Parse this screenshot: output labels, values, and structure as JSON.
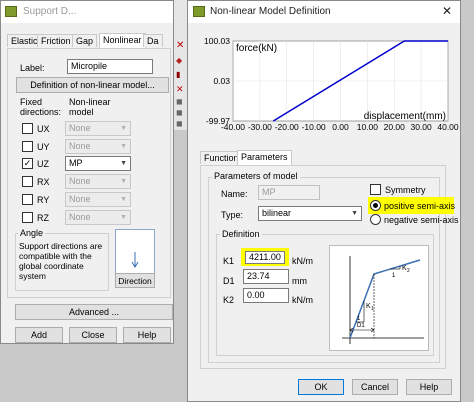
{
  "support_dialog": {
    "title": "Support D...",
    "tabs": [
      "Elastic",
      "Friction",
      "Gap",
      "Nonlinear",
      "Da"
    ],
    "label_caption": "Label:",
    "label_value": "Micropile",
    "definition_button": "Definition of non-linear model...",
    "fixed_directions_header": "Fixed\ndirections:",
    "nonlinear_model_header": "Non-linear\nmodel",
    "directions": [
      {
        "name": "UX",
        "checked": false,
        "model": "None"
      },
      {
        "name": "UY",
        "checked": false,
        "model": "None"
      },
      {
        "name": "UZ",
        "checked": true,
        "model": "MP"
      },
      {
        "name": "RX",
        "checked": false,
        "model": "None"
      },
      {
        "name": "RY",
        "checked": false,
        "model": "None"
      },
      {
        "name": "RZ",
        "checked": false,
        "model": "None"
      }
    ],
    "angle_title": "Angle",
    "angle_text": "Support directions are compatible with the global coordinate system",
    "direction_button": "Direction",
    "advanced_button": "Advanced ...",
    "add_button": "Add",
    "close_button": "Close",
    "help_button": "Help"
  },
  "nonlinear_dialog": {
    "title": "Non-linear Model Definition",
    "close_glyph": "✕",
    "tabs": [
      "Functions",
      "Parameters"
    ],
    "params_group_title": "Parameters of model",
    "name_caption": "Name:",
    "name_value": "MP",
    "type_caption": "Type:",
    "type_value": "bilinear",
    "symmetry_label": "Symmetry",
    "positive_label": "positive semi-axis",
    "negative_label": "negative semi-axis",
    "definition_group_title": "Definition",
    "k1_caption": "K1",
    "k1_value": "4211.00",
    "k1_unit": "kN/m",
    "d1_caption": "D1",
    "d1_value": "23.74",
    "d1_unit": "mm",
    "k2_caption": "K2",
    "k2_value": "0.00",
    "k2_unit": "kN/m",
    "sketch_labels": {
      "k1": "K",
      "k1_sub": "1",
      "k2": "K",
      "k2_sub": "2",
      "d1": "D1",
      "one_a": "1",
      "one_b": "1"
    },
    "ok_button": "OK",
    "cancel_button": "Cancel",
    "help_button": "Help"
  },
  "chart_data": {
    "type": "line",
    "ylabel": "force(kN)",
    "xlabel": "displacement(mm)",
    "x_ticks": [
      "-40.00",
      "-30.00",
      "-20.00",
      "-10.00",
      "0.00",
      "10.00",
      "20.00",
      "30.00",
      "40.00"
    ],
    "y_ticks": [
      "100.03",
      "0.03",
      "-99.97"
    ],
    "xlim": [
      -40,
      40
    ],
    "ylim": [
      -99.97,
      100.03
    ],
    "series": [
      {
        "x": [
          -25,
          23.74,
          40
        ],
        "y": [
          -99.97,
          100.03,
          100.03
        ]
      }
    ],
    "line_color": "#0000cc"
  },
  "background_toolbar_glyphs": [
    "✕",
    "◆",
    "▮",
    "✕",
    "◼",
    "◼",
    "◼"
  ]
}
